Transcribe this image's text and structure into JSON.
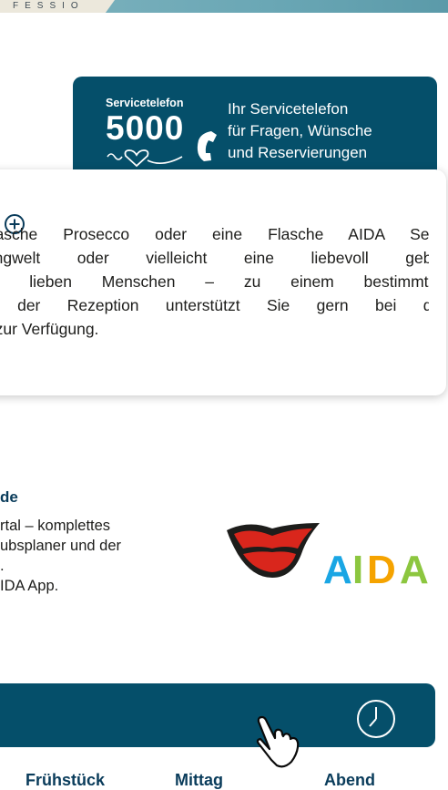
{
  "header": {
    "ribbon_text": "FESSIO"
  },
  "service": {
    "badge_label": "Servicetelefon",
    "badge_number": "5000",
    "description_lines": [
      "Ihr Servicetelefon",
      "für Fragen, Wünsche",
      "und Reservierungen"
    ]
  },
  "info": {
    "lines": [
      "Flasche Prosecco oder eine Flasche AIDA Sekt,",
      "pingwelt oder vielleicht eine liebevoll geba-",
      "en lieben Menschen – zu einem bestimmten",
      "n der Rezeption unterstützt Sie gern bei der",
      "n zur Verfügung."
    ]
  },
  "app_section": {
    "title": "de",
    "lines": [
      "rtal – komplettes",
      "ubsplaner und der",
      ".",
      "IDA App."
    ]
  },
  "brand": {
    "logo_text": "AIDA"
  },
  "bottom": {
    "tabs": [
      "Frühstück",
      "Mittag",
      "Abend"
    ]
  },
  "icons": {
    "phone": "phone-icon",
    "heart": "heart-icon",
    "plus": "plus-circle-icon",
    "clock": "clock-icon",
    "hand": "pointing-hand-icon"
  },
  "colors": {
    "primary": "#054f6a",
    "heading": "#0a3c5b",
    "lips": "#d9261c"
  }
}
